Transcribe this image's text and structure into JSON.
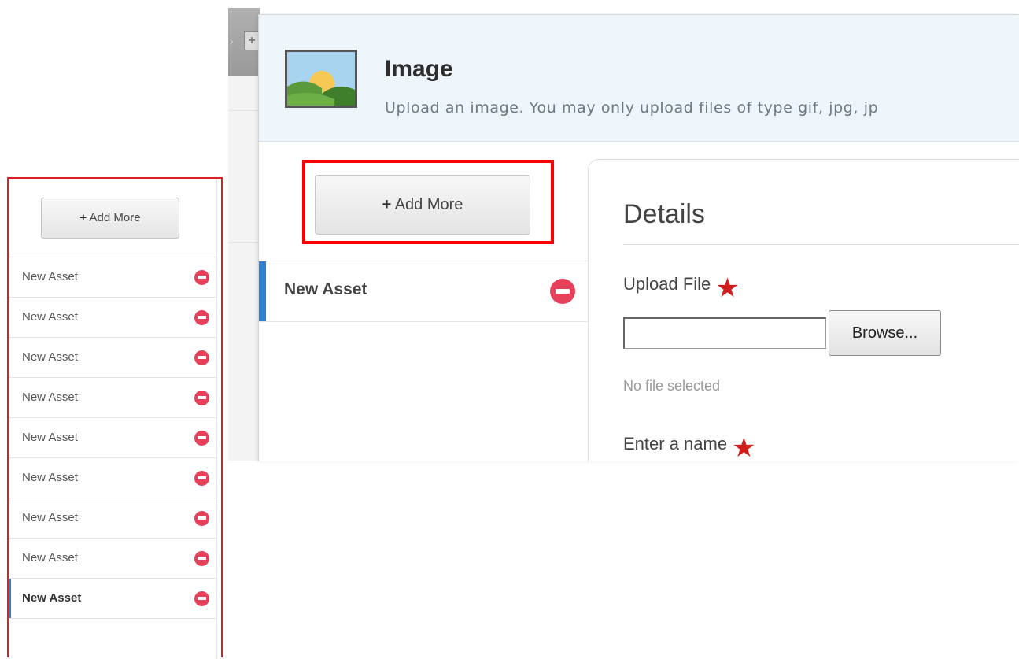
{
  "dialog": {
    "title": "Image",
    "subtitle": "Upload an image. You may only upload files of type gif, jpg, jp",
    "icon": "image-landscape-icon"
  },
  "uploader": {
    "add_more_plus": "+",
    "add_more_label": "Add More",
    "assets": [
      {
        "label": "New Asset",
        "active": true,
        "remove_icon": "remove-circle-icon"
      }
    ]
  },
  "details": {
    "title": "Details",
    "upload_file_label": "Upload File",
    "required_marker": "★",
    "browse_label": "Browse...",
    "file_input_value": "",
    "file_status": "No file selected",
    "name_label": "Enter a name"
  },
  "small_panel": {
    "add_more_plus": "+",
    "add_more_label": "Add More",
    "items": [
      {
        "label": "New Asset"
      },
      {
        "label": "New Asset"
      },
      {
        "label": "New Asset"
      },
      {
        "label": "New Asset"
      },
      {
        "label": "New Asset"
      },
      {
        "label": "New Asset"
      },
      {
        "label": "New Asset"
      },
      {
        "label": "New Asset"
      },
      {
        "label": "New Asset"
      }
    ]
  },
  "colors": {
    "highlight": "#ff0000",
    "remove": "#e6405a",
    "active_bar": "#2f7fd2",
    "required": "#d31c1c",
    "header_bg": "#eef5fb"
  }
}
